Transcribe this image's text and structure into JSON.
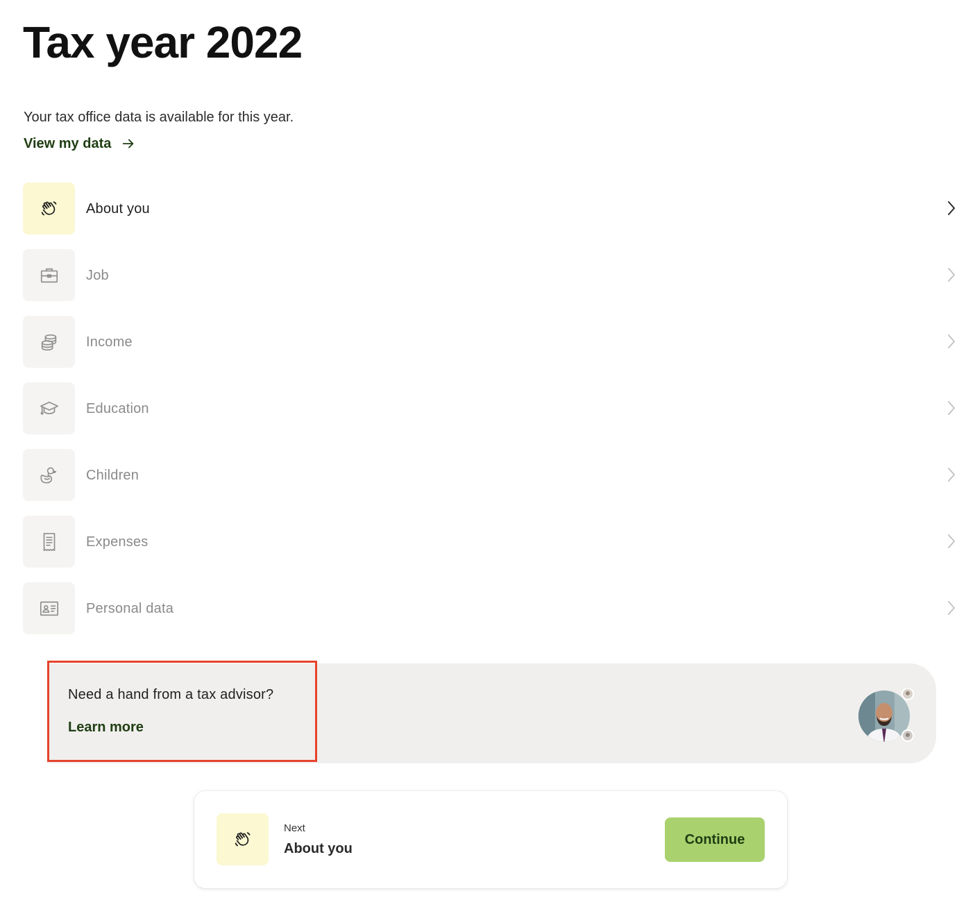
{
  "page": {
    "title": "Tax year 2022",
    "subtitle": "Your tax office data is available for this year.",
    "view_data_link": "View my data"
  },
  "categories": [
    {
      "label": "About you",
      "icon": "waving-hand-icon",
      "active": true
    },
    {
      "label": "Job",
      "icon": "briefcase-icon",
      "active": false
    },
    {
      "label": "Income",
      "icon": "coins-icon",
      "active": false
    },
    {
      "label": "Education",
      "icon": "graduation-cap-icon",
      "active": false
    },
    {
      "label": "Children",
      "icon": "rubber-duck-icon",
      "active": false
    },
    {
      "label": "Expenses",
      "icon": "receipt-icon",
      "active": false
    },
    {
      "label": "Personal data",
      "icon": "id-card-icon",
      "active": false
    }
  ],
  "advisor": {
    "question": "Need a hand from a tax advisor?",
    "link": "Learn more",
    "avatar": "tax-advisor-avatar"
  },
  "next_step": {
    "kicker": "Next",
    "title": "About you",
    "icon": "waving-hand-icon",
    "button_label": "Continue"
  },
  "colors": {
    "brand_green": "#1f3d12",
    "button_green": "#a9d26f",
    "active_tile": "#fbf8d2",
    "inactive_tile": "#f5f4f2",
    "highlight": "#e6432c"
  }
}
